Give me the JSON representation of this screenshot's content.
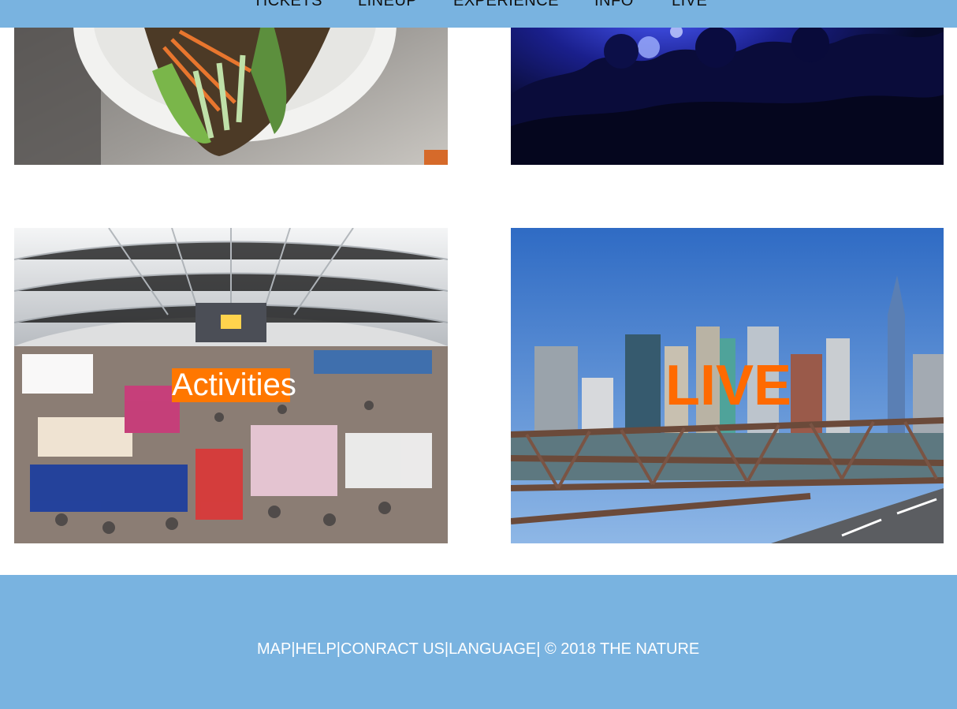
{
  "nav": {
    "items": [
      "TICKETS",
      "LINEUP",
      "EXPERIENCE",
      "INFO",
      "LIVE"
    ]
  },
  "tiles": {
    "food": {
      "image": "food-bowl-photo"
    },
    "concert": {
      "image": "concert-crowd-photo"
    },
    "activities": {
      "image": "expo-hall-crowd-photo",
      "label": "Activities"
    },
    "live": {
      "image": "city-skyline-bridge-photo",
      "label": "LIVE"
    }
  },
  "footer": {
    "links": [
      "MAP",
      "HELP",
      "CONRACT US",
      "LANGUAGE"
    ],
    "separator": "|",
    "copyright": " © 2018 THE NATURE"
  },
  "colors": {
    "nav_bar": "#79b3e0",
    "footer_bg": "#79b3e0",
    "accent_orange": "#ff7700"
  }
}
